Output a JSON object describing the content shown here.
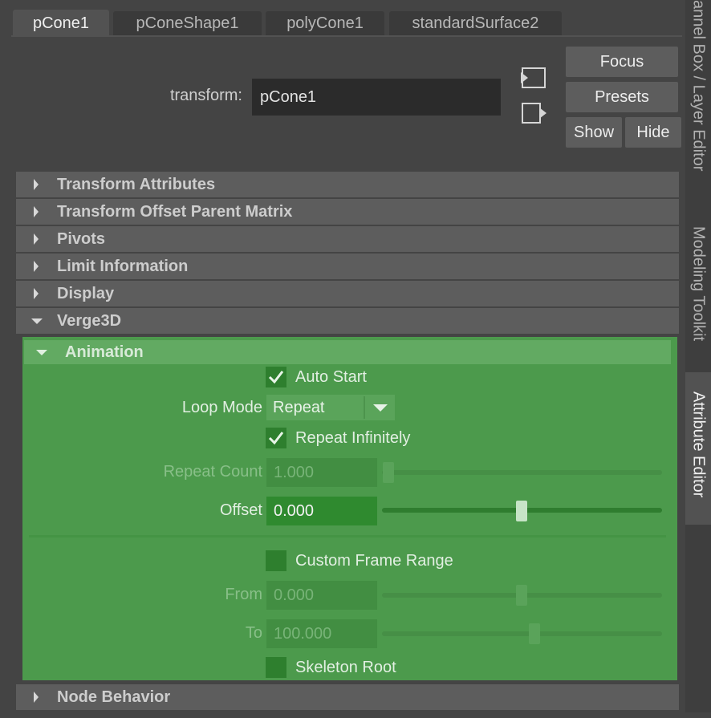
{
  "tabs": [
    {
      "label": "pCone1",
      "active": true
    },
    {
      "label": "pConeShape1",
      "active": false
    },
    {
      "label": "polyCone1",
      "active": false
    },
    {
      "label": "standardSurface2",
      "active": false
    }
  ],
  "transform": {
    "label": "transform:",
    "value": "pCone1"
  },
  "buttons": {
    "focus": "Focus",
    "presets": "Presets",
    "show": "Show",
    "hide": "Hide"
  },
  "sections": [
    {
      "label": "Transform Attributes",
      "expanded": false
    },
    {
      "label": "Transform Offset Parent Matrix",
      "expanded": false
    },
    {
      "label": "Pivots",
      "expanded": false
    },
    {
      "label": "Limit Information",
      "expanded": false
    },
    {
      "label": "Display",
      "expanded": false
    },
    {
      "label": "Verge3D",
      "expanded": true
    }
  ],
  "animation": {
    "header": "Animation",
    "auto_start": {
      "label": "Auto Start",
      "checked": true
    },
    "loop_mode": {
      "label": "Loop Mode",
      "value": "Repeat"
    },
    "repeat_infinitely": {
      "label": "Repeat Infinitely",
      "checked": true
    },
    "repeat_count": {
      "label": "Repeat Count",
      "value": "1.000",
      "slider_fraction": 0.0
    },
    "offset": {
      "label": "Offset",
      "value": "0.000",
      "slider_fraction": 0.5
    },
    "custom_frame_range": {
      "label": "Custom Frame Range",
      "checked": false
    },
    "from": {
      "label": "From",
      "value": "0.000",
      "slider_fraction": 0.5
    },
    "to": {
      "label": "To",
      "value": "100.000",
      "slider_fraction": 0.55
    },
    "skeleton_root": {
      "label": "Skeleton Root",
      "checked": false
    }
  },
  "node_behavior": {
    "label": "Node Behavior",
    "expanded": false
  },
  "side_tabs": [
    {
      "label": "annel Box / Layer Editor",
      "active": false
    },
    {
      "label": "Modeling Toolkit",
      "active": false
    },
    {
      "label": "Attribute Editor",
      "active": true
    }
  ],
  "colors": {
    "accent_green": "#4c9a4c",
    "panel_bg": "#444444",
    "section_bg": "#5d5d5d"
  },
  "icons": {
    "select": "select-object-icon",
    "load": "load-selected-icon",
    "collapsed": "triangle-right-icon",
    "expanded": "triangle-down-icon"
  }
}
